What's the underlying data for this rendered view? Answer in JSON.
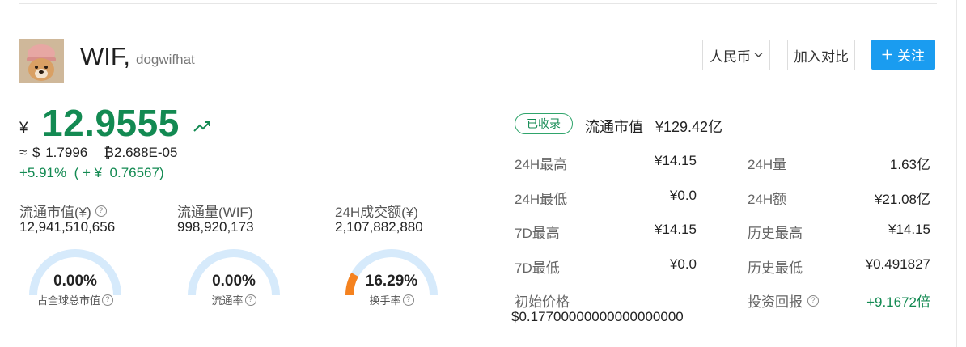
{
  "coin": {
    "symbol": "WIF,",
    "name": "dogwifhat"
  },
  "header": {
    "currency_select": "人民币",
    "compare_label": "加入对比",
    "follow_label": "关注",
    "follow_icon": "plus-icon"
  },
  "price": {
    "currency_symbol": "¥",
    "value": "12.9555",
    "trend_icon": "trend-up-icon",
    "approx_usd": "≈ $ 1.7996",
    "approx_btc": "₿2.688E-05",
    "change": "+5.91%  ( + ¥  0.76567)"
  },
  "stats": [
    {
      "label": "流通市值(¥)",
      "value": "12,941,510,656",
      "has_help": true
    },
    {
      "label": "流通量(WIF)",
      "value": "998,920,173",
      "has_help": false
    },
    {
      "label": "24H成交额(¥)",
      "value": "2,107,882,880",
      "has_help": false
    }
  ],
  "gauges": [
    {
      "value": "0.00%",
      "fraction": 0.0,
      "label": "占全球总市值"
    },
    {
      "value": "0.00%",
      "fraction": 0.0,
      "label": "流通率"
    },
    {
      "value": "16.29%",
      "fraction": 0.1629,
      "label": "换手率"
    }
  ],
  "market": {
    "tag": "已收录",
    "mcap_label": "流通市值",
    "mcap_value": "¥129.42亿"
  },
  "details_left": [
    {
      "label": "24H最高",
      "value": "¥14.15"
    },
    {
      "label": "24H最低",
      "value": "¥0.0"
    },
    {
      "label": "7D最高",
      "value": "¥14.15"
    },
    {
      "label": "7D最低",
      "value": "¥0.0"
    }
  ],
  "details_right": [
    {
      "label": "24H量",
      "value": "1.63亿"
    },
    {
      "label": "24H额",
      "value": "¥21.08亿"
    },
    {
      "label": "历史最高",
      "value": "¥14.15"
    },
    {
      "label": "历史最低",
      "value": "¥0.491827"
    },
    {
      "label": "投资回报",
      "value": "+9.1672倍"
    }
  ],
  "initial": {
    "label": "初始价格",
    "value": "$0.17700000000000000000"
  },
  "colors": {
    "up": "#138a52",
    "accent": "#1a9cf0",
    "gauge_track": "#d6eafb",
    "gauge_fill": "#f5821f"
  }
}
